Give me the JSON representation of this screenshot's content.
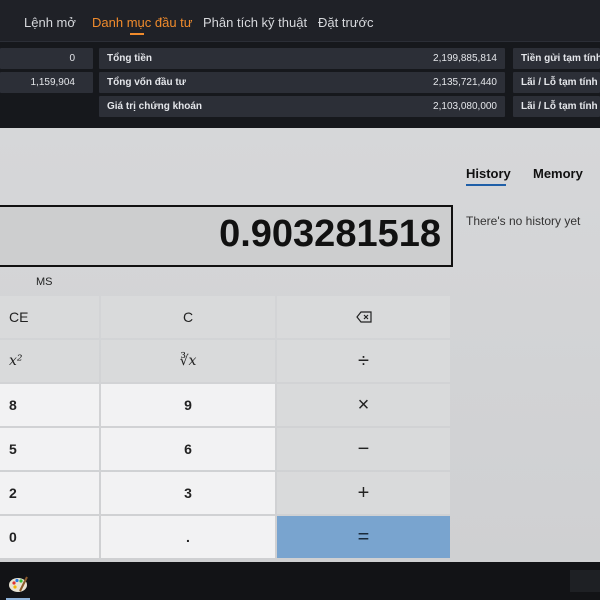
{
  "tabs": [
    {
      "label": "Lệnh mở"
    },
    {
      "label": "Danh mục đầu tư"
    },
    {
      "label": "Phân tích kỹ thuật"
    },
    {
      "label": "Đặt trước"
    }
  ],
  "summary": {
    "left_values": [
      "0",
      "1,159,904"
    ],
    "middle": [
      {
        "label": "Tổng tiền",
        "value": "2,199,885,814"
      },
      {
        "label": "Tổng vốn đầu tư",
        "value": "2,135,721,440"
      },
      {
        "label": "Giá trị chứng khoán",
        "value": "2,103,080,000"
      }
    ],
    "right": [
      {
        "label": "Tiền gửi tạm tính"
      },
      {
        "label": "Lãi / Lỗ tạm tính (V"
      },
      {
        "label": "Lãi / Lỗ tạm tính (%"
      }
    ]
  },
  "calculator": {
    "display": "0.903281518",
    "memory_label": "MS",
    "keys": {
      "ce": "CE",
      "c": "C",
      "backspace": "⌫",
      "square": "x²",
      "cube_root": "∛x",
      "divide": "÷",
      "n8": "8",
      "n9": "9",
      "multiply": "×",
      "n5": "5",
      "n6": "6",
      "minus": "−",
      "n2": "2",
      "n3": "3",
      "plus": "+",
      "n0": "0",
      "decimal": ".",
      "equals": "="
    },
    "panel": {
      "history_tab": "History",
      "memory_tab": "Memory",
      "empty_message": "There's no history yet"
    }
  },
  "colors": {
    "accent_tab": "#f08b2c",
    "equals_key": "#79a4cf",
    "history_underline": "#1f5fa8"
  }
}
